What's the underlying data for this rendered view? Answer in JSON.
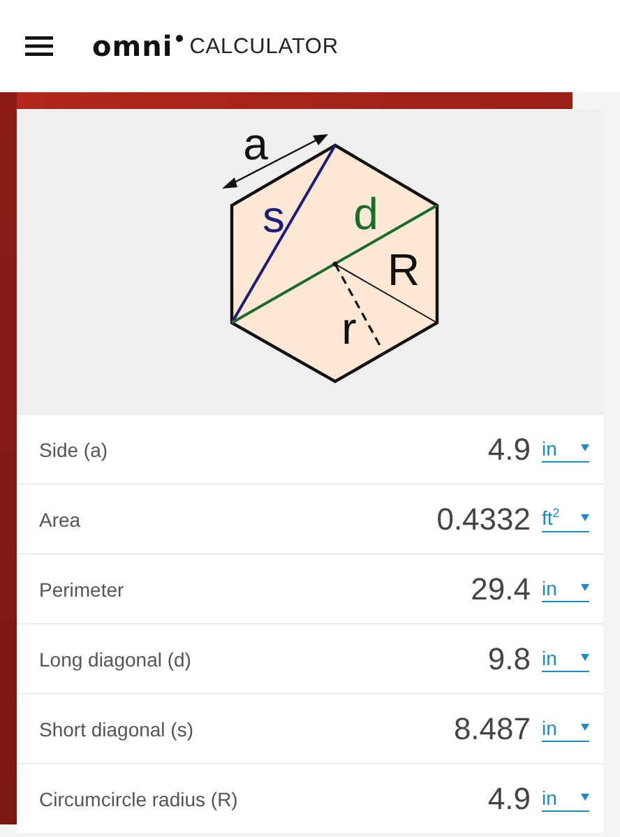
{
  "header": {
    "logo_word": "omni",
    "logo_suffix": "CALCULATOR"
  },
  "diagram": {
    "labels": [
      {
        "kind": "side",
        "text": "a"
      },
      {
        "kind": "short",
        "text": "s"
      },
      {
        "kind": "long",
        "text": "d"
      },
      {
        "kind": "circum",
        "text": "R"
      },
      {
        "kind": "in",
        "text": "r"
      }
    ]
  },
  "rows": [
    {
      "label": "Side (a)",
      "value": "4.9",
      "unit": "in"
    },
    {
      "label": "Area",
      "value": "0.4332",
      "unit": "ft$^{2}$"
    },
    {
      "label": "Perimeter",
      "value": "29.4",
      "unit": "in"
    },
    {
      "label": "Long diagonal (d)",
      "value": "9.8",
      "unit": "in"
    },
    {
      "label": "Short diagonal (s)",
      "value": "8.487",
      "unit": "in"
    },
    {
      "label": "Circumcircle radius (R)",
      "value": "4.9",
      "unit": "in"
    }
  ]
}
